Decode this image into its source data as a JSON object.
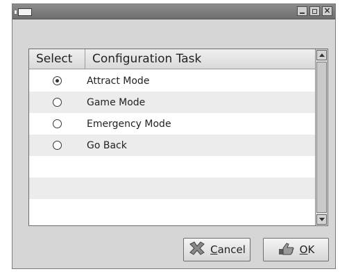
{
  "window": {
    "title": ""
  },
  "table": {
    "headers": {
      "select": "Select",
      "task": "Configuration Task"
    },
    "rows": [
      {
        "label": "Attract Mode",
        "selected": true
      },
      {
        "label": "Game Mode",
        "selected": false
      },
      {
        "label": "Emergency Mode",
        "selected": false
      },
      {
        "label": "Go Back",
        "selected": false
      }
    ]
  },
  "buttons": {
    "cancel_label": "Cancel",
    "ok_label": "OK"
  },
  "icons": {
    "cancel": "cancel-icon",
    "ok": "ok-hand-icon"
  }
}
